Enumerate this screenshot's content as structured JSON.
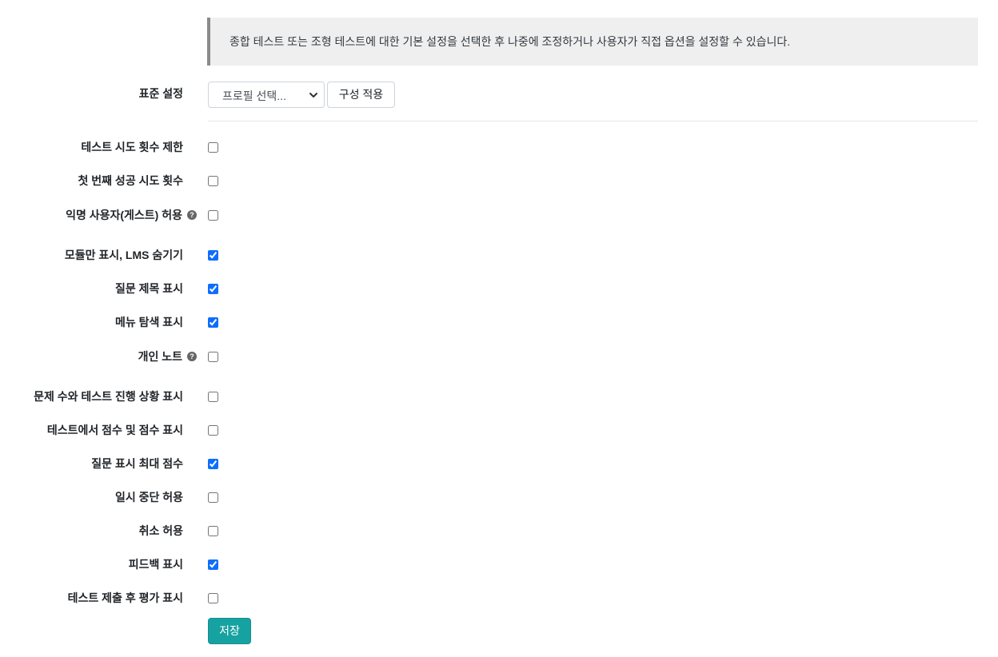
{
  "notice": {
    "text": "종합 테스트 또는 조형 테스트에 대한 기본 설정을 선택한 후 나중에 조정하거나 사용자가 직접 옵션을 설정할 수 있습니다."
  },
  "preset": {
    "label": "표준 설정",
    "select_value": "프로필 선택...",
    "apply_label": "구성 적용"
  },
  "options": [
    {
      "label": "테스트 시도 횟수 제한",
      "checked": false,
      "help": false
    },
    {
      "label": "첫 번째 성공 시도 횟수",
      "checked": false,
      "help": false
    },
    {
      "label": "익명 사용자(게스트) 허용",
      "checked": false,
      "help": true
    },
    {
      "label": "모듈만 표시, LMS 숨기기",
      "checked": true,
      "help": false
    },
    {
      "label": "질문 제목 표시",
      "checked": true,
      "help": false
    },
    {
      "label": "메뉴 탐색 표시",
      "checked": true,
      "help": false
    },
    {
      "label": "개인 노트",
      "checked": false,
      "help": true
    },
    {
      "label": "문제 수와 테스트 진행 상황 표시",
      "checked": false,
      "help": false
    },
    {
      "label": "테스트에서 점수 및 점수 표시",
      "checked": false,
      "help": false
    },
    {
      "label": "질문 표시 최대 점수",
      "checked": true,
      "help": false
    },
    {
      "label": "일시 중단 허용",
      "checked": false,
      "help": false
    },
    {
      "label": "취소 허용",
      "checked": false,
      "help": false
    },
    {
      "label": "피드백 표시",
      "checked": true,
      "help": false
    },
    {
      "label": "테스트 제출 후 평가 표시",
      "checked": false,
      "help": false
    }
  ],
  "save_label": "저장",
  "colors": {
    "accent": "#0d6efd",
    "save": "#17a2a2"
  }
}
